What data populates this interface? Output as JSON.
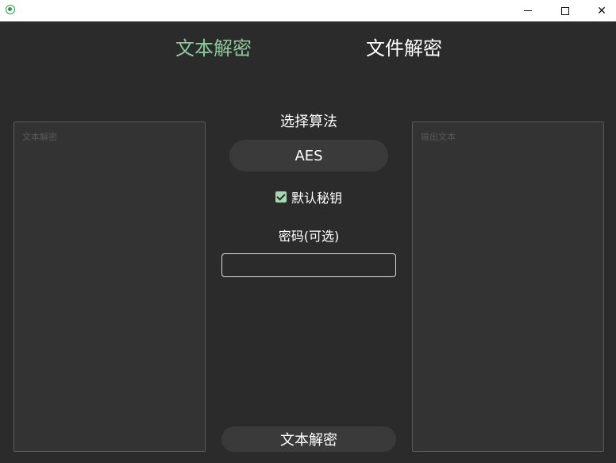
{
  "window": {
    "icon": "app-icon",
    "controls": {
      "minimize": "minimize-icon",
      "maximize": "maximize-icon",
      "close": "✕"
    }
  },
  "tabs": {
    "text_decrypt": "文本解密",
    "file_decrypt": "文件解密"
  },
  "input_panel": {
    "placeholder": "文本解密"
  },
  "output_panel": {
    "placeholder": "输出文本"
  },
  "algorithm": {
    "label": "选择算法",
    "selected": "AES"
  },
  "default_key": {
    "label": "默认秘钥",
    "checked": true
  },
  "password": {
    "label": "密码(可选)",
    "value": ""
  },
  "submit": {
    "label": "文本解密"
  },
  "colors": {
    "background": "#2b2b2b",
    "active_tab": "#8cc99a",
    "checkbox": "#a6d9b0",
    "panel": "#333333"
  }
}
